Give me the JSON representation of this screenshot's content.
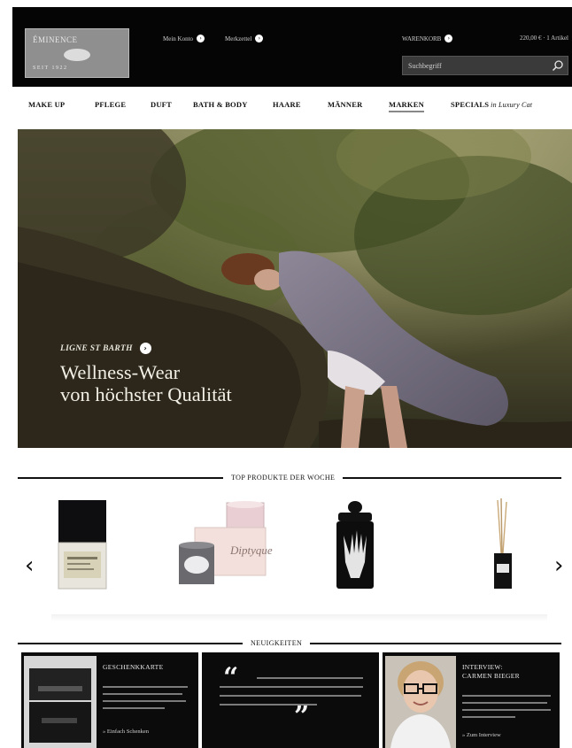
{
  "header": {
    "logo_top": "ÉMINENCE",
    "logo_bottom": "SEIT 1922",
    "links": [
      {
        "label": "Mein Konto"
      },
      {
        "label": "Merkzettel"
      }
    ],
    "cart_label": "WARENKORB",
    "cart_summary": "220,00 € · 1 Artikel",
    "search_placeholder": "Suchbegriff"
  },
  "nav": {
    "items": [
      {
        "label": "MAKE UP"
      },
      {
        "label": "PFLEGE"
      },
      {
        "label": "DUFT"
      },
      {
        "label": "BATH & BODY"
      },
      {
        "label": "HAARE"
      },
      {
        "label": "MÄNNER"
      },
      {
        "label": "MARKEN",
        "active": true
      },
      {
        "label": "SPECIALS",
        "suffix": "in Luxury Cat"
      }
    ]
  },
  "hero": {
    "kicker": "LIGNE ST BARTH",
    "headline_line1": "Wellness-Wear",
    "headline_line2": "von höchster Qualität"
  },
  "top_products": {
    "title": "TOP PRODUKTE DER WOCHE",
    "items": [
      {
        "name": "perfume-bottle"
      },
      {
        "name": "candle-set"
      },
      {
        "name": "hand-candle"
      },
      {
        "name": "reed-diffuser"
      }
    ]
  },
  "news": {
    "title": "NEUIGKEITEN",
    "cards": [
      {
        "title": "GESCHENKKARTE",
        "link": "» Einfach Schenken"
      },
      {
        "quote_open": "“",
        "quote_close": "”"
      },
      {
        "title_line1": "INTERVIEW:",
        "title_line2": "CARMEN BIEGER",
        "link": "» Zum Interview"
      }
    ]
  },
  "colors": {
    "header_bg": "#050505",
    "accent_gray": "#8f8f8f"
  }
}
